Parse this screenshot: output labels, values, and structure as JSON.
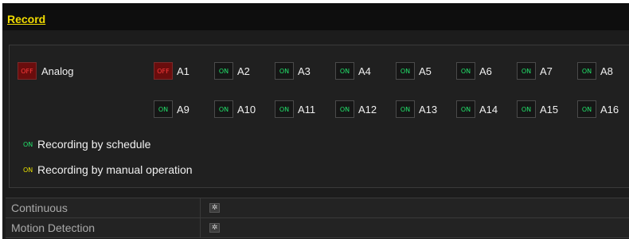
{
  "title": "Record",
  "analog": {
    "label": "Analog",
    "state": "OFF"
  },
  "channels": [
    {
      "name": "A1",
      "state": "OFF"
    },
    {
      "name": "A2",
      "state": "ON"
    },
    {
      "name": "A3",
      "state": "ON"
    },
    {
      "name": "A4",
      "state": "ON"
    },
    {
      "name": "A5",
      "state": "ON"
    },
    {
      "name": "A6",
      "state": "ON"
    },
    {
      "name": "A7",
      "state": "ON"
    },
    {
      "name": "A8",
      "state": "ON"
    },
    {
      "name": "A9",
      "state": "ON"
    },
    {
      "name": "A10",
      "state": "ON"
    },
    {
      "name": "A11",
      "state": "ON"
    },
    {
      "name": "A12",
      "state": "ON"
    },
    {
      "name": "A13",
      "state": "ON"
    },
    {
      "name": "A14",
      "state": "ON"
    },
    {
      "name": "A15",
      "state": "ON"
    },
    {
      "name": "A16",
      "state": "ON"
    }
  ],
  "legend": [
    {
      "icon": "ON",
      "color": "#22e16a",
      "text": "Recording by schedule"
    },
    {
      "icon": "ON",
      "color": "#e8e000",
      "text": "Recording by manual operation"
    }
  ],
  "modes": [
    {
      "label": "Continuous",
      "icon": "gear-icon"
    },
    {
      "label": "Motion Detection",
      "icon": "gear-icon"
    }
  ],
  "colors": {
    "title": "#f2dc00",
    "on": "#22e16a",
    "off": "#ff3b3b",
    "off_bg": "#6a0d0d",
    "manual": "#e8e000"
  }
}
